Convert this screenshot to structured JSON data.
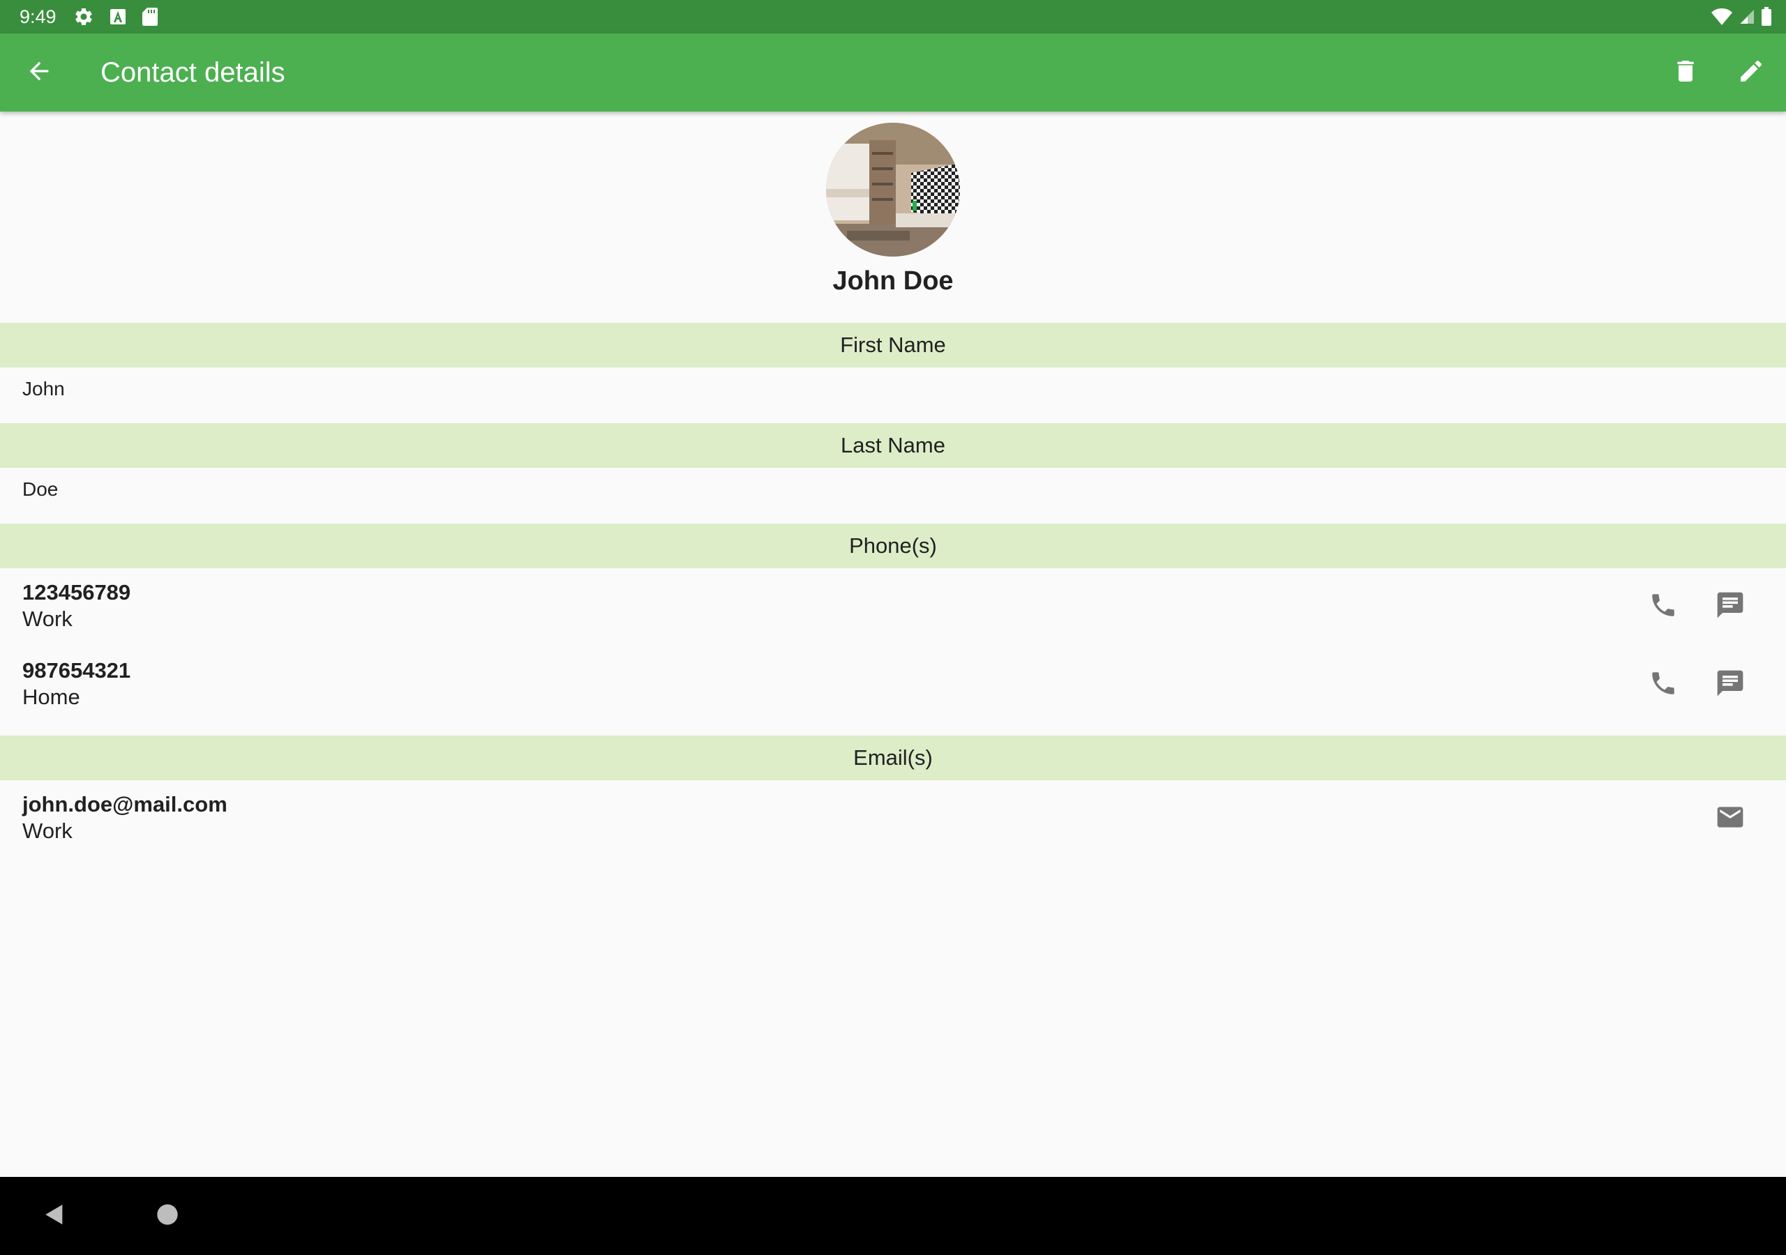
{
  "status_bar": {
    "time": "9:49",
    "icons_left": [
      "settings-icon",
      "font-a-icon",
      "sd-card-icon"
    ],
    "icons_right": [
      "wifi-icon",
      "cell-signal-icon",
      "battery-icon"
    ]
  },
  "app_bar": {
    "title": "Contact details",
    "color": "#4caf50",
    "status_color": "#388e3c",
    "actions": [
      "back-arrow-icon",
      "delete-icon",
      "edit-icon"
    ]
  },
  "contact": {
    "display_name": "John Doe",
    "avatar": "photo-of-room-interior"
  },
  "sections": {
    "first_name": {
      "header": "First Name",
      "value": "John"
    },
    "last_name": {
      "header": "Last Name",
      "value": "Doe"
    },
    "phones": {
      "header": "Phone(s)",
      "items": [
        {
          "number": "123456789",
          "type": "Work"
        },
        {
          "number": "987654321",
          "type": "Home"
        }
      ]
    },
    "emails": {
      "header": "Email(s)",
      "items": [
        {
          "address": "john.doe@mail.com",
          "type": "Work"
        }
      ]
    }
  },
  "colors": {
    "section_header_bg": "#dcedc8",
    "icon_gray": "#757575",
    "background": "#fafafa"
  },
  "nav_bar": {
    "buttons": [
      "nav-back-icon",
      "nav-home-icon"
    ]
  }
}
